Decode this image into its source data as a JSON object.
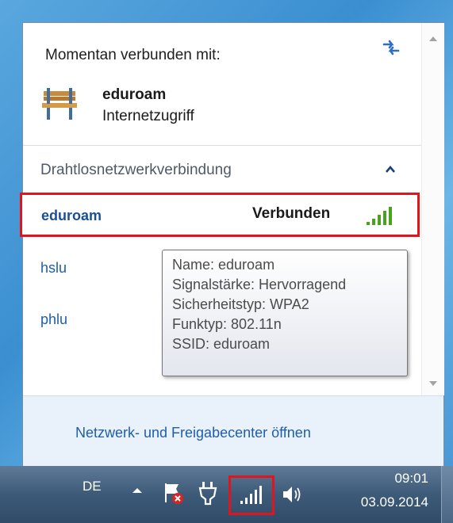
{
  "flyout": {
    "connected_label": "Momentan verbunden mit:",
    "current_connection": {
      "name": "eduroam",
      "access": "Internetzugriff"
    },
    "section_title": "Drahtlosnetzwerkverbindung",
    "networks": [
      {
        "name": "eduroam",
        "status": "Verbunden",
        "selected": true
      },
      {
        "name": "hslu"
      },
      {
        "name": "phlu"
      }
    ],
    "tooltip": [
      "Name: eduroam",
      "Signalstärke: Hervorragend",
      "Sicherheitstyp: WPA2",
      "Funktyp: 802.11n",
      "SSID: eduroam"
    ],
    "footer_link": "Netzwerk- und Freigabecenter öffnen"
  },
  "taskbar": {
    "language": "DE",
    "time": "09:01",
    "date": "03.09.2014",
    "icons": [
      "show-hidden-icons-icon",
      "action-center-icon",
      "power-icon",
      "network-signal-icon",
      "volume-icon"
    ]
  },
  "colors": {
    "link": "#1f5ea8",
    "highlight": "#e1161c",
    "signal": "#4aa31f",
    "footer_bg": "#e9f1fb"
  }
}
